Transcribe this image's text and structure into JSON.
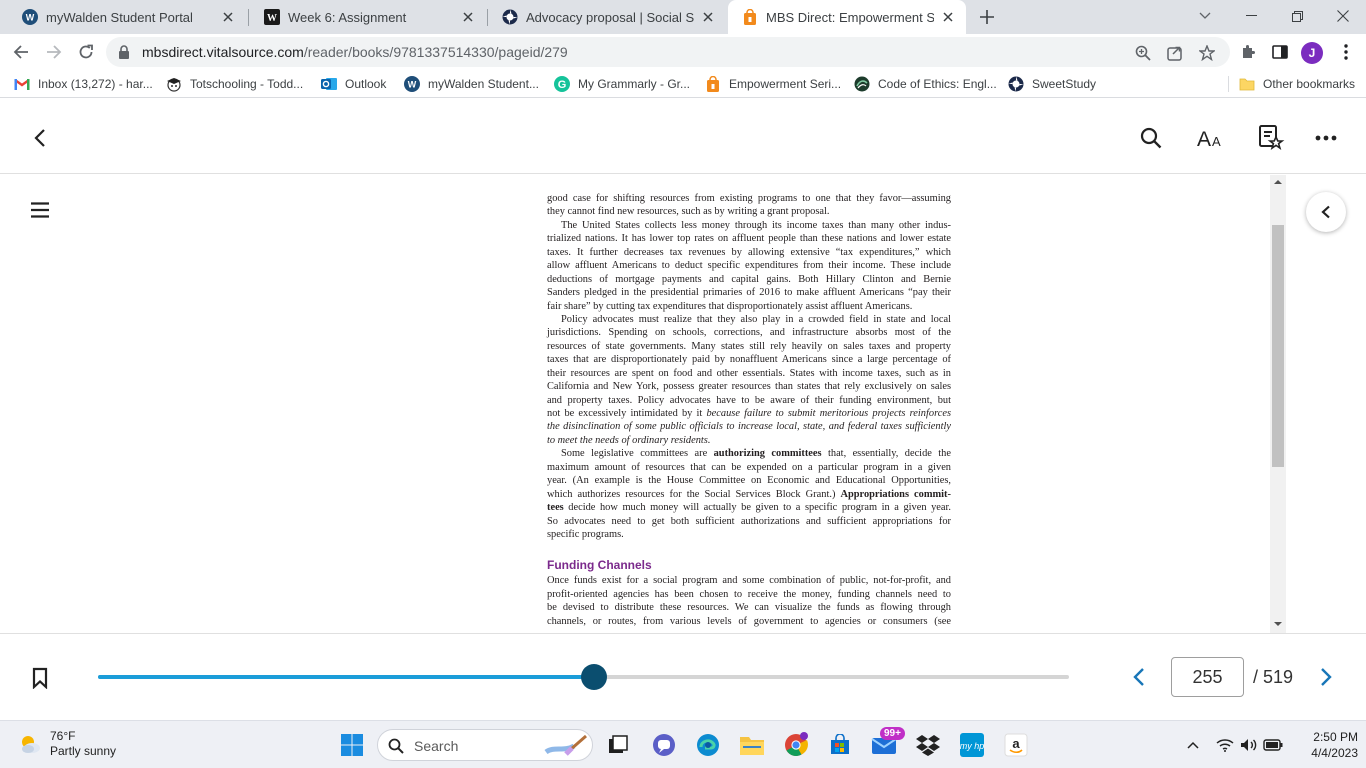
{
  "browser": {
    "tabs": [
      {
        "title": "myWalden Student Portal",
        "icon": "walden-w-icon",
        "active": false
      },
      {
        "title": "Week 6: Assignment",
        "icon": "walden-w-square-icon",
        "active": false
      },
      {
        "title": "Advocacy proposal | Social Scien",
        "icon": "sweetstudy-icon",
        "active": false
      },
      {
        "title": "MBS Direct: Empowerment Serie",
        "icon": "mbs-bag-icon",
        "active": true
      }
    ],
    "url": {
      "host": "mbsdirect.vitalsource.com",
      "path": "/reader/books/9781337514330/pageid/279"
    },
    "profile_initial": "J",
    "bookmarks": [
      {
        "label": "Inbox (13,272) - har...",
        "icon": "gmail-icon"
      },
      {
        "label": "Totschooling - Todd...",
        "icon": "totschooling-icon"
      },
      {
        "label": "Outlook",
        "icon": "outlook-icon"
      },
      {
        "label": "myWalden Student...",
        "icon": "walden-w-icon"
      },
      {
        "label": "My Grammarly - Gr...",
        "icon": "grammarly-icon"
      },
      {
        "label": "Empowerment Seri...",
        "icon": "mbs-bag-icon"
      },
      {
        "label": "Code of Ethics: Engl...",
        "icon": "nasw-icon"
      },
      {
        "label": "SweetStudy",
        "icon": "sweetstudy-icon"
      }
    ],
    "other_bookmarks": "Other bookmarks"
  },
  "reader": {
    "paragraphs": [
      {
        "type": "para",
        "indent": false,
        "lines": [
          {
            "t": "good case for shifting resources from existing programs to one that they favor—assuming"
          },
          {
            "t": "they cannot find new resources, such as by writing a grant proposal.",
            "last": true
          }
        ]
      },
      {
        "type": "para",
        "indent": true,
        "lines": [
          {
            "t": "The United States collects less money through its income taxes than many other indus-"
          },
          {
            "t": "trialized nations. It has lower top rates on affluent people than these nations and lower estate"
          },
          {
            "t": "taxes. It further decreases tax revenues by allowing extensive “tax expenditures,” which"
          },
          {
            "t": "allow affluent Americans to deduct specific expenditures from their income. These include"
          },
          {
            "t": "deductions of mortgage payments and capital gains. Both Hillary Clinton and Bernie"
          },
          {
            "t": "Sanders pledged in the presidential primaries of 2016 to make affluent Americans “pay their"
          },
          {
            "t": "fair share” by cutting tax expenditures that disproportionately assist affluent Americans.",
            "last": true
          }
        ]
      },
      {
        "type": "para",
        "indent": true,
        "lines": [
          {
            "t": "Policy advocates must realize that they also play in a crowded field in state and local"
          },
          {
            "t": "jurisdictions. Spending on schools, corrections, and infrastructure absorbs most of the"
          },
          {
            "t": "resources of state governments. Many states still rely heavily on sales taxes and property"
          },
          {
            "t": "taxes that are disproportionately paid by nonaffluent Americans since a large percentage of"
          },
          {
            "t": "their resources are spent on food and other essentials. States with income taxes, such as in"
          },
          {
            "t": "California and New York, possess greater resources than states that rely exclusively on sales"
          },
          {
            "t": "and property taxes. Policy advocates have to be aware of their funding environment, but"
          },
          {
            "t": "not be excessively intimidated by it ",
            "i": "because failure to submit meritorious projects reinforces"
          },
          {
            "t": "",
            "i": "the disinclination of some public officials to increase local, state, and federal taxes sufficiently"
          },
          {
            "t": "",
            "i": "to meet the needs of ordinary residents.",
            "last": true
          }
        ]
      },
      {
        "type": "para",
        "indent": true,
        "lines": [
          {
            "t": "Some legislative committees are ",
            "b": "authorizing committees",
            "t2": " that, essentially, decide the"
          },
          {
            "t": "maximum amount of resources that can be expended on a particular program in a given"
          },
          {
            "t": "year. (An example is the House Committee on Economic and Educational Opportunities,"
          },
          {
            "t": "which authorizes resources for the Social Services Block Grant.) ",
            "b": "Appropriations commit-"
          },
          {
            "t": "",
            "b": "tees",
            "t2": " decide how much money will actually be given to a specific program in a given year."
          },
          {
            "t": "So advocates need to get both sufficient authorizations and sufficient appropriations for"
          },
          {
            "t": "specific programs.",
            "last": true
          }
        ]
      },
      {
        "type": "heading",
        "text": "Funding Channels"
      },
      {
        "type": "para",
        "indent": false,
        "lines": [
          {
            "t": "Once funds exist for a social program and some combination of public, not-for-profit, and"
          },
          {
            "t": "profit-oriented agencies has been chosen to receive the money, funding channels need to"
          },
          {
            "t": "be devised to distribute these resources. We can visualize the funds as flowing through"
          },
          {
            "t": "channels, or routes, from various levels of government to agencies or consumers (see"
          }
        ]
      }
    ],
    "current_page": "255",
    "total_pages": "/ 519",
    "progress_fraction": 0.511
  },
  "taskbar": {
    "weather_temp": "76°F",
    "weather_desc": "Partly sunny",
    "search_placeholder": "Search",
    "notification_badge": "99+",
    "time": "2:50 PM",
    "date": "4/4/2023"
  },
  "colors": {
    "accent": "#1b9dd9",
    "slider_thumb": "#0b4e6f",
    "heading": "#7b2a8c"
  }
}
